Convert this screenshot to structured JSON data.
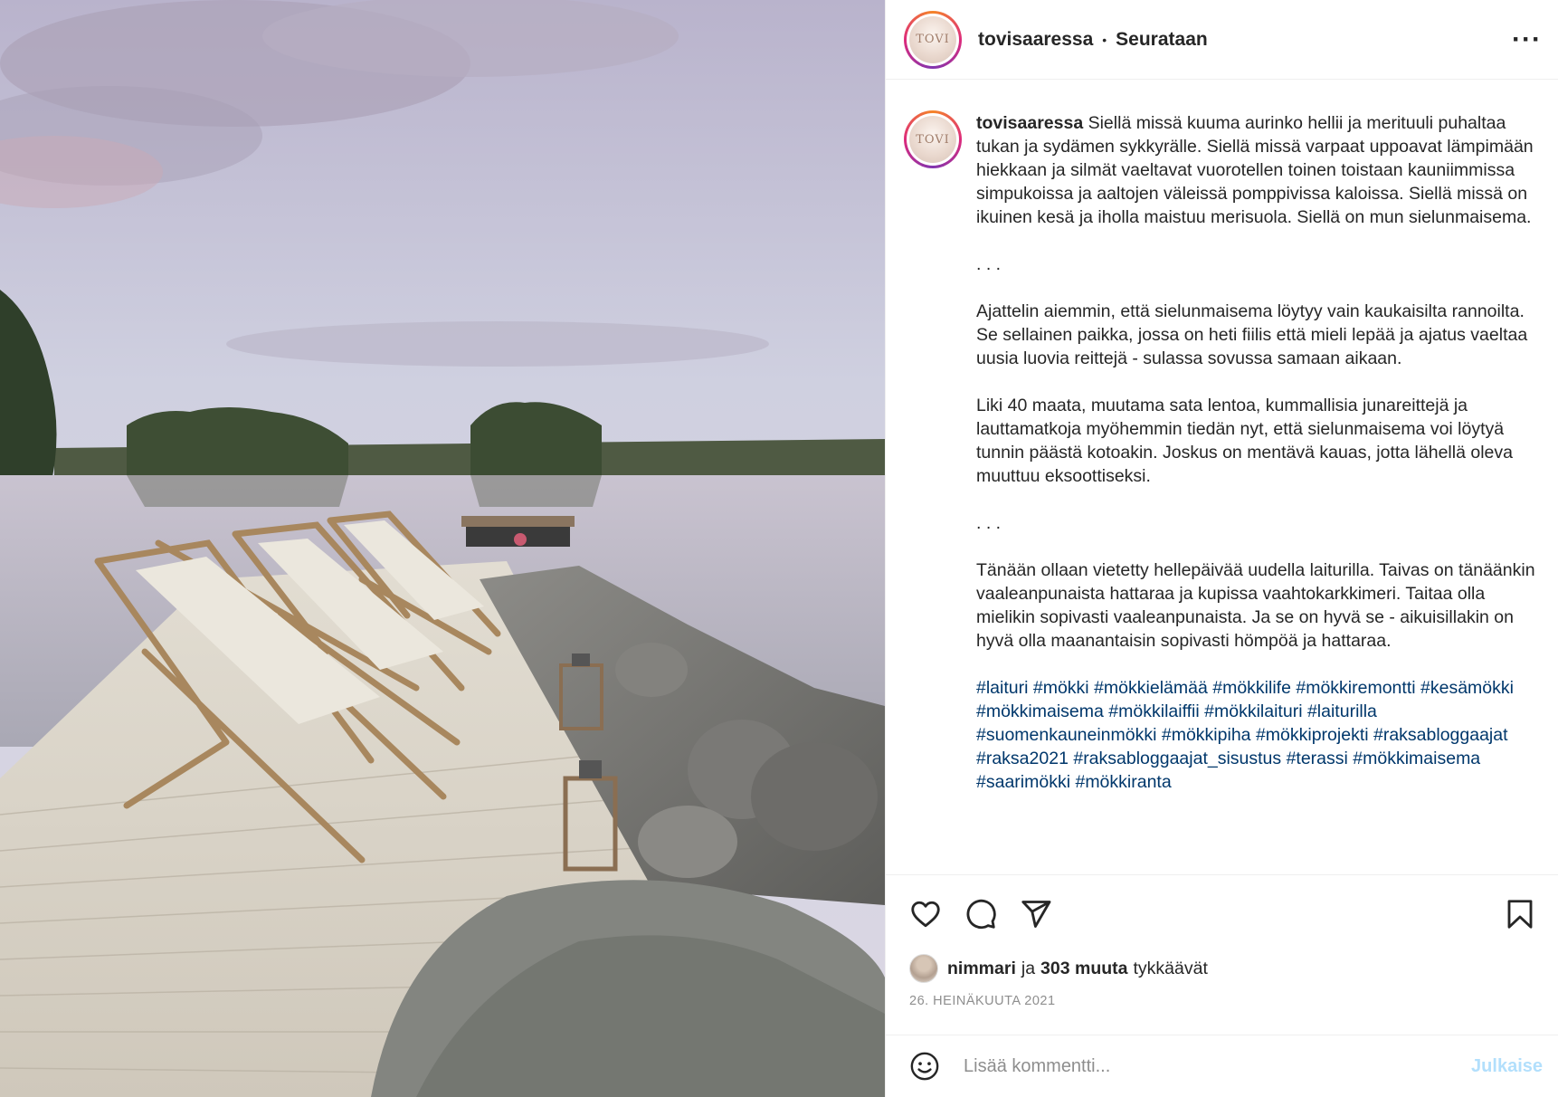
{
  "post": {
    "username": "tovisaaressa",
    "follow_status": "Seurataan",
    "more_label": "···",
    "avatar_text": "TOVI"
  },
  "caption": {
    "username": "tovisaaressa",
    "paragraphs": [
      "Siellä missä kuuma aurinko hellii ja merituuli puhaltaa tukan ja sydämen sykkyrälle. Siellä missä varpaat uppoavat lämpimään hiekkaan ja silmät vaeltavat vuorotellen toinen toistaan kauniimmissa simpukoissa ja aaltojen väleissä pomppivissa kaloissa. Siellä missä on ikuinen kesä ja iholla maistuu merisuola. Siellä on mun sielunmaisema.",
      ". . .",
      "Ajattelin aiemmin, että sielunmaisema löytyy vain kaukaisilta rannoilta. Se sellainen paikka, jossa on heti fiilis että mieli lepää ja ajatus vaeltaa uusia luovia reittejä - sulassa sovussa samaan aikaan.",
      "Liki 40 maata, muutama sata lentoa, kummallisia junareittejä ja lauttamatkoja myöhemmin tiedän nyt, että sielunmaisema voi löytyä tunnin päästä kotoakin. Joskus on mentävä kauas, jotta lähellä oleva muuttuu eksoottiseksi.",
      ". . .",
      "Tänään ollaan vietetty hellepäivää uudella laiturilla. Taivas on tänäänkin vaaleanpunaista hattaraa ja kupissa vaahtokarkkimeri. Taitaa olla mielikin sopivasti vaaleanpunaista. Ja se on hyvä se - aikuisillakin on hyvä olla maanantaisin sopivasti hömpöä ja hattaraa."
    ],
    "hashtags": [
      "#laituri",
      "#mökki",
      "#mökkielämää",
      "#mökkilife",
      "#mökkiremontti",
      "#kesämökki",
      "#mökkimaisema",
      "#mökkilaiffii",
      "#mökkilaituri",
      "#laiturilla",
      "#suomenkauneinmökki",
      "#mökkipiha",
      "#mökkiprojekti",
      "#raksabloggaajat",
      "#raksa2021",
      "#raksabloggaajat_sisustus",
      "#terassi",
      "#mökkimaisema",
      "#saarimökki",
      "#mökkiranta"
    ]
  },
  "likes": {
    "liker": "nimmari",
    "conjunction": "ja",
    "others": "303 muuta",
    "suffix": "tykkäävät"
  },
  "date": "26. HEINÄKUUTA 2021",
  "comment": {
    "placeholder": "Lisää kommentti...",
    "post_label": "Julkaise"
  },
  "icons": [
    "heart-icon",
    "comment-icon",
    "share-icon",
    "bookmark-icon",
    "emoji-icon"
  ],
  "colors": {
    "link": "#00376b",
    "muted": "#8e8e8e",
    "post_disabled": "#b2dffc"
  }
}
